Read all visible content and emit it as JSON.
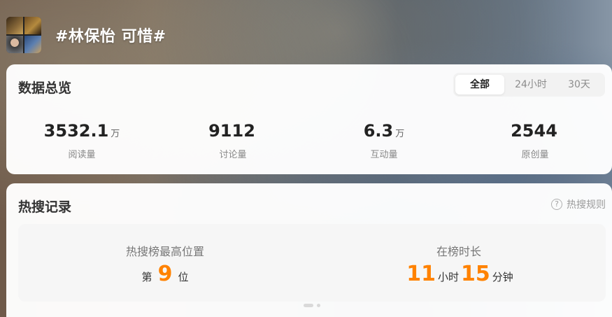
{
  "header": {
    "title": "#林保怡 可惜#",
    "avatar": "topic-avatar-collage"
  },
  "overview": {
    "title": "数据总览",
    "tabs": [
      {
        "label": "全部",
        "active": true
      },
      {
        "label": "24小时",
        "active": false
      },
      {
        "label": "30天",
        "active": false
      }
    ],
    "stats": [
      {
        "value": "3532.1",
        "unit": "万",
        "label": "阅读量"
      },
      {
        "value": "9112",
        "unit": "",
        "label": "讨论量"
      },
      {
        "value": "6.3",
        "unit": "万",
        "label": "互动量"
      },
      {
        "value": "2544",
        "unit": "",
        "label": "原创量"
      }
    ]
  },
  "hot": {
    "title": "热搜记录",
    "rules_label": "热搜规则",
    "rules_icon": "help-circle-icon",
    "peak": {
      "label": "热搜榜最高位置",
      "prefix": "第",
      "value": "9",
      "suffix": "位"
    },
    "duration": {
      "label": "在榜时长",
      "hours": "11",
      "hours_unit": "小时",
      "minutes": "15",
      "minutes_unit": "分钟"
    }
  },
  "colors": {
    "accent": "#ff8200",
    "card": "#ffffff",
    "panel": "#f6f6f6"
  }
}
